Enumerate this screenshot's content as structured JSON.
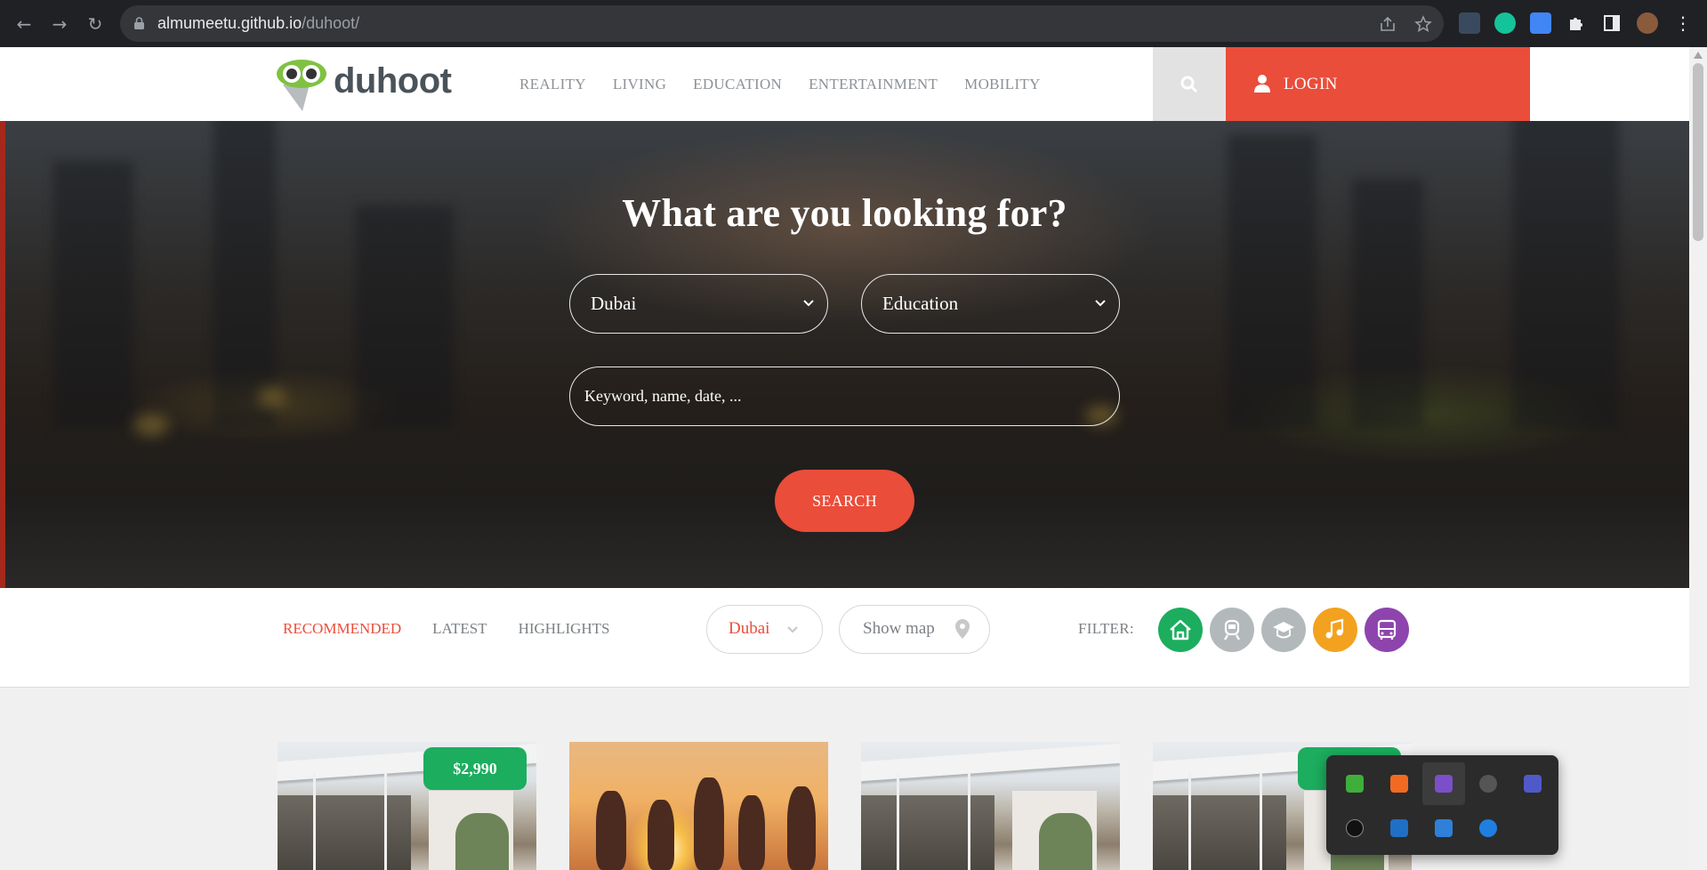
{
  "browser": {
    "url_host": "almumeetu.github.io",
    "url_path": "/duhoot/"
  },
  "header": {
    "logo_text": "duhoot",
    "nav": [
      "REALITY",
      "LIVING",
      "EDUCATION",
      "ENTERTAINMENT",
      "MOBILITY"
    ],
    "login_label": "LOGIN"
  },
  "hero": {
    "title": "What are you looking for?",
    "location_value": "Dubai",
    "category_value": "Education",
    "keyword_placeholder": "Keyword, name, date, ...",
    "search_label": "SEARCH"
  },
  "filter_bar": {
    "tabs": [
      "RECOMMENDED",
      "LATEST",
      "HIGHLIGHTS"
    ],
    "active_tab": "RECOMMENDED",
    "city_value": "Dubai",
    "show_map_label": "Show map",
    "filter_label": "FILTER:",
    "categories": [
      {
        "icon": "house-icon",
        "color": "#1cad5e"
      },
      {
        "icon": "train-icon",
        "color": "#b3b9bb"
      },
      {
        "icon": "graduation-cap-icon",
        "color": "#b3b9bb"
      },
      {
        "icon": "music-icon",
        "color": "#f3a21f"
      },
      {
        "icon": "bus-icon",
        "color": "#8e44ad"
      }
    ]
  },
  "cards": [
    {
      "image": "house",
      "price": "$2,990"
    },
    {
      "image": "party",
      "price": ""
    },
    {
      "image": "house",
      "price": ""
    },
    {
      "image": "house",
      "price": ""
    }
  ],
  "colors": {
    "accent": "#ea4d3a",
    "price_badge": "#1cad5e",
    "nav_text": "#8d9196"
  }
}
